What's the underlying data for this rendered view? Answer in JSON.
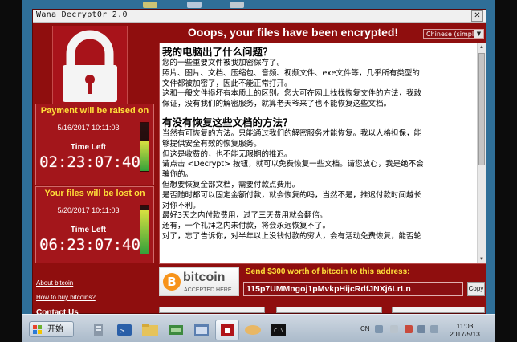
{
  "window": {
    "title": "Wana Decrypt0r 2.0",
    "close_glyph": "✕"
  },
  "headline": "Ooops, your files have been encrypted!",
  "language_select": {
    "value": "Chinese (simpl",
    "arrow": "▼"
  },
  "panels": {
    "raise": {
      "heading": "Payment will be raised on",
      "date": "5/16/2017 10:11:03",
      "time_left_label": "Time Left",
      "countdown": "02:23:07:40",
      "progress_fraction": 0.62
    },
    "lost": {
      "heading": "Your files will be lost on",
      "date": "5/20/2017 10:11:03",
      "time_left_label": "Time Left",
      "countdown": "06:23:07:40",
      "progress_fraction": 0.9
    }
  },
  "links": {
    "about_bitcoin": "About bitcoin",
    "how_to_buy": "How to buy bitcoins?",
    "contact": "Contact Us"
  },
  "message": {
    "heading1": "我的电脑出了什么问题？",
    "para1": [
      "您的一些重要文件被我加密保存了。",
      "照片、图片、文档、压缩包、音频、视频文件、exe文件等，几乎所有类型的",
      "文件都被加密了，因此不能正常打开。",
      "这和一般文件损坏有本质上的区别。您大可在网上找找恢复文件的方法，我敢",
      "保证，没有我们的解密服务，就算老天爷来了也不能恢复这些文档。"
    ],
    "heading2": "有没有恢复这些文档的方法？",
    "para2": [
      "当然有可恢复的方法。只能通过我们的解密服务才能恢复。我以人格担保，能",
      "够提供安全有效的恢复服务。",
      "但这是收费的，也不能无限期的推迟。",
      "请点击 <Decrypt> 按钮，就可以免费恢复一些文档。请您放心，我是绝不会",
      "骗你的。",
      "但想要恢复全部文档，需要付款点费用。",
      "是否随时都可以固定金额付款，就会恢复的吗，当然不是，推迟付款时间越长",
      "对你不利。",
      "最好3天之内付款费用，过了三天费用就会翻倍。",
      "还有，一个礼拜之内未付款，将会永远恢复不了。",
      "对了，忘了告诉你，对半年以上没钱付款的穷人，会有活动免费恢复，能否轮"
    ]
  },
  "payment": {
    "send_text": "Send $300 worth of bitcoin to this address:",
    "address": "115p7UMMngoj1pMvkpHijcRdfJNXj6LrLn",
    "copy_label": "Copy",
    "bitcoin_logo_word": "bitcoin",
    "bitcoin_logo_sub": "ACCEPTED HERE",
    "bitcoin_symbol": "B"
  },
  "taskbar": {
    "start_label": "开始",
    "lang_indicator": "CN",
    "clock_time": "11:03",
    "clock_date": "2017/5/13"
  },
  "colors": {
    "window_red": "#8f0e0e",
    "panel_heading_yellow": "#ffe03a",
    "bitcoin_orange": "#f7931a"
  }
}
